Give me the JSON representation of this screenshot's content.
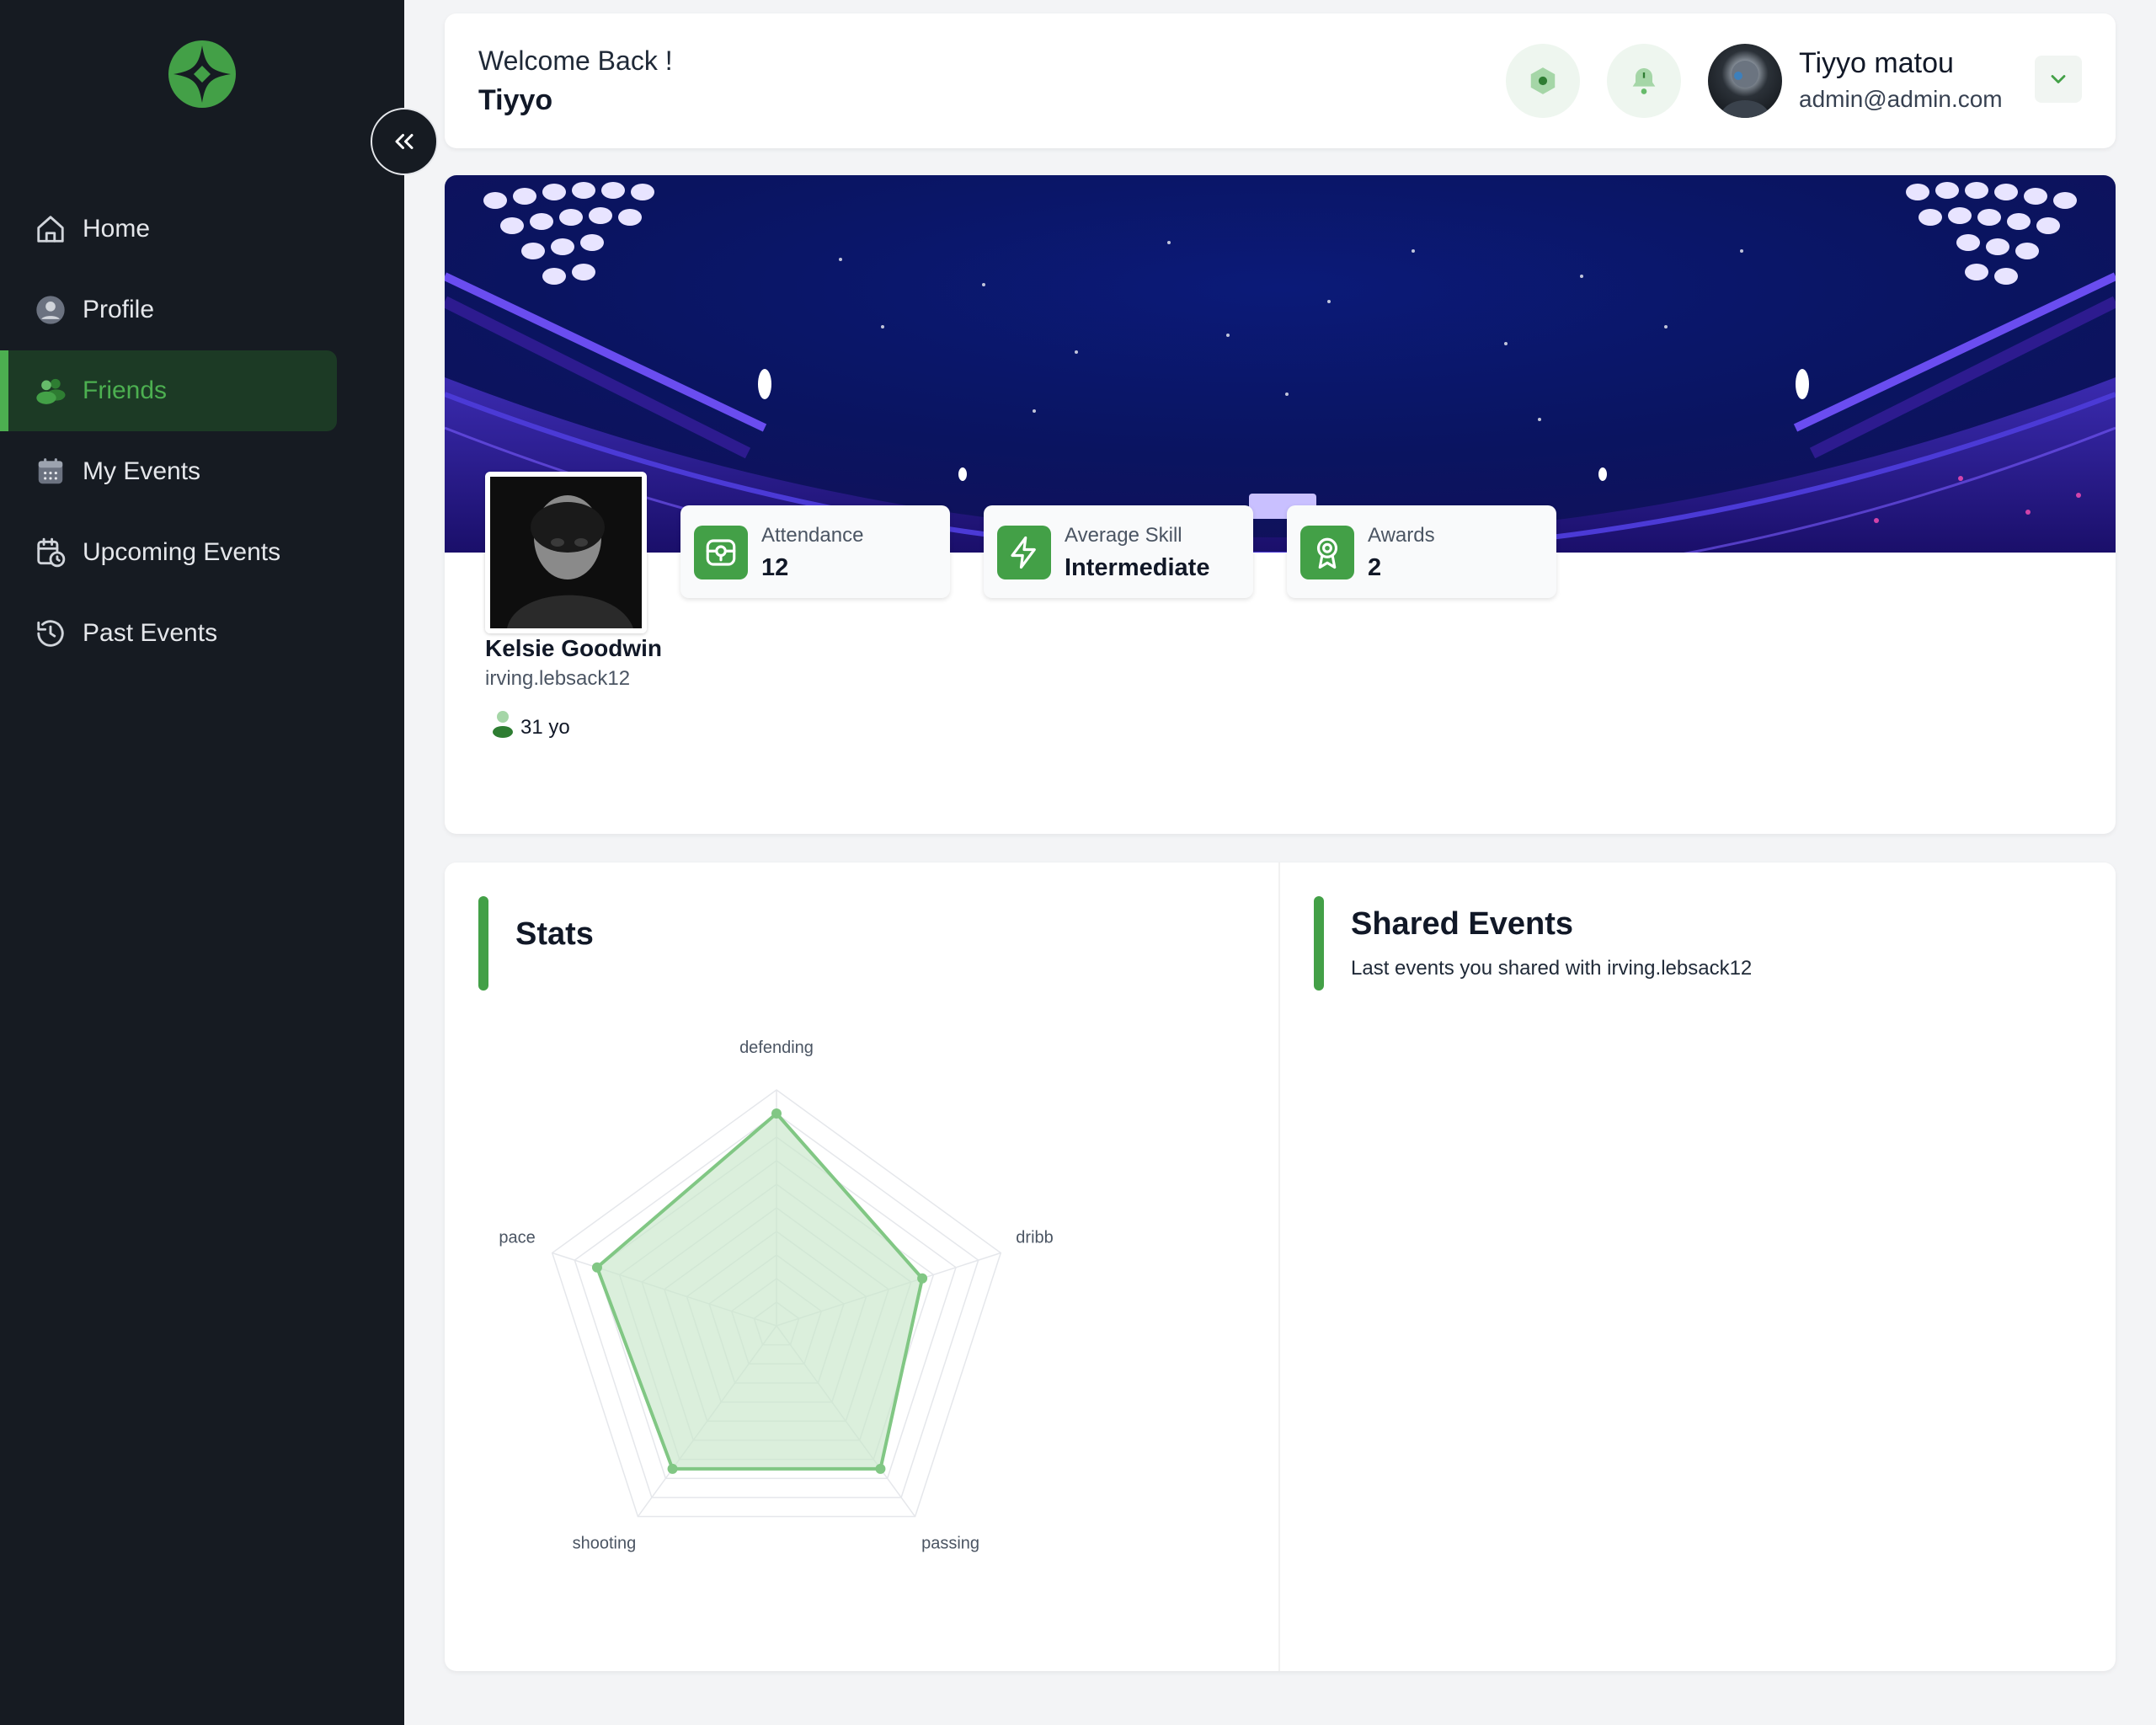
{
  "sidebar": {
    "logo_icon": "star-compass-logo",
    "collapse_icon": "chevrons-left-icon",
    "items": [
      {
        "label": "Home",
        "icon": "home-icon",
        "active": false
      },
      {
        "label": "Profile",
        "icon": "user-circle-icon",
        "active": false
      },
      {
        "label": "Friends",
        "icon": "users-icon",
        "active": true
      },
      {
        "label": "My Events",
        "icon": "calendar-icon",
        "active": false
      },
      {
        "label": "Upcoming Events",
        "icon": "calendar-clock-icon",
        "active": false
      },
      {
        "label": "Past Events",
        "icon": "history-icon",
        "active": false
      }
    ]
  },
  "header": {
    "greeting": "Welcome Back !",
    "name": "Tiyyo",
    "user": {
      "name": "Tiyyo matou",
      "email": "admin@admin.com"
    }
  },
  "profile": {
    "name": "Kelsie Goodwin",
    "handle": "irving.lebsack12",
    "age": "31 yo",
    "stats": [
      {
        "label": "Attendance",
        "value": "12",
        "icon": "ticket-icon"
      },
      {
        "label": "Average Skill",
        "value": "Intermediate",
        "icon": "lightning-icon"
      },
      {
        "label": "Awards",
        "value": "2",
        "icon": "award-icon"
      }
    ]
  },
  "stats_section": {
    "title": "Stats"
  },
  "shared_events": {
    "title": "Shared Events",
    "subtitle": "Last events you shared with irving.lebsack12"
  },
  "colors": {
    "accent": "#43a047",
    "sidebar_bg": "#161b22",
    "radar_fill": "#c8e6c9",
    "radar_stroke": "#81c784"
  },
  "chart_data": {
    "type": "radar",
    "categories": [
      "defending",
      "dribbling",
      "passing",
      "shooting",
      "pace"
    ],
    "values": [
      9,
      6.5,
      7.5,
      7.5,
      8
    ],
    "max": 10,
    "grid_levels": 10
  }
}
